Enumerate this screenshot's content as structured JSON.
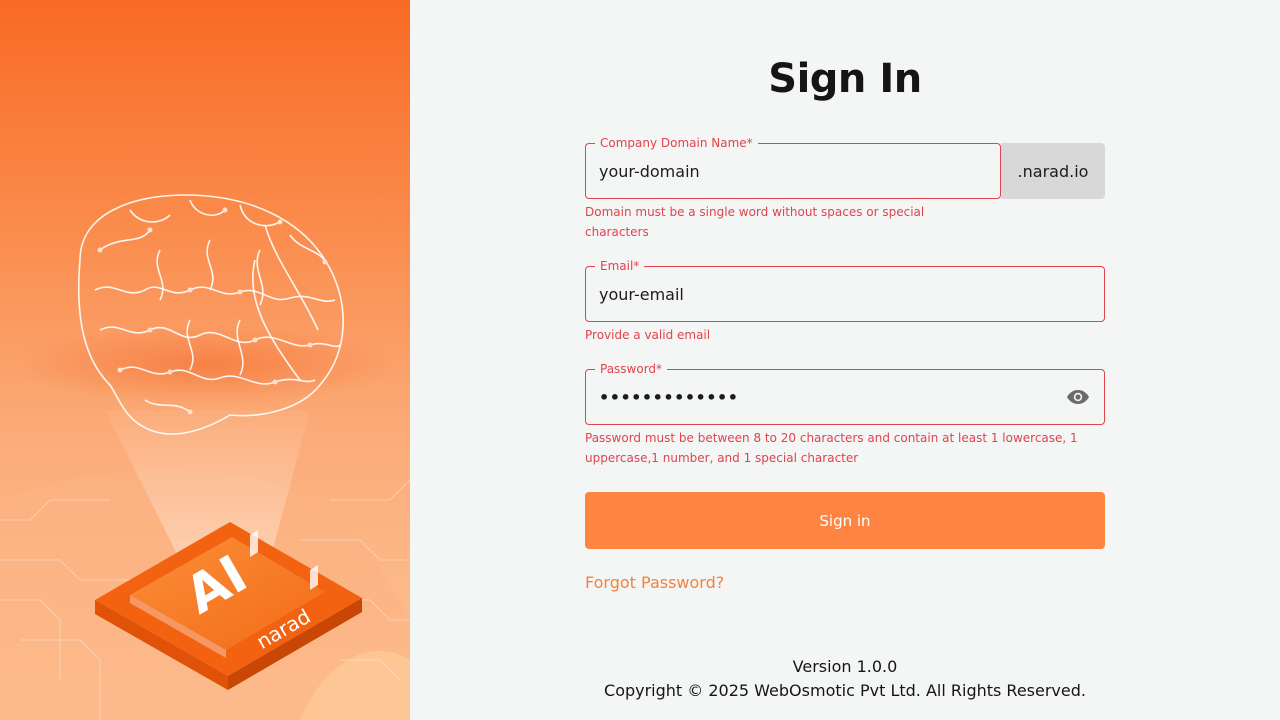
{
  "hero": {
    "chip_text": "AI",
    "chip_brand": "narad"
  },
  "form": {
    "title": "Sign In",
    "domain": {
      "label": "Company Domain Name*",
      "value": "your-domain",
      "suffix": ".narad.io",
      "error_line1": "Domain must be a single word without spaces or special",
      "error_line2": "characters"
    },
    "email": {
      "label": "Email*",
      "value": "your-email",
      "error": "Provide a valid email"
    },
    "password": {
      "label": "Password*",
      "masked_value": "•••••••••••••",
      "toggle_icon": "eye-icon",
      "error_line1": "Password must be between 8 to 20 characters and contain at least 1 lowercase, 1",
      "error_line2": "uppercase,1 number, and 1 special character"
    },
    "submit_label": "Sign in",
    "forgot_label": "Forgot Password?"
  },
  "footer": {
    "version": "Version 1.0.0",
    "copyright": "Copyright © 2025 WebOsmotic Pvt Ltd. All Rights Reserved."
  },
  "colors": {
    "accent": "#fe8442",
    "error": "#e0444d",
    "background": "#f4f5f5"
  }
}
